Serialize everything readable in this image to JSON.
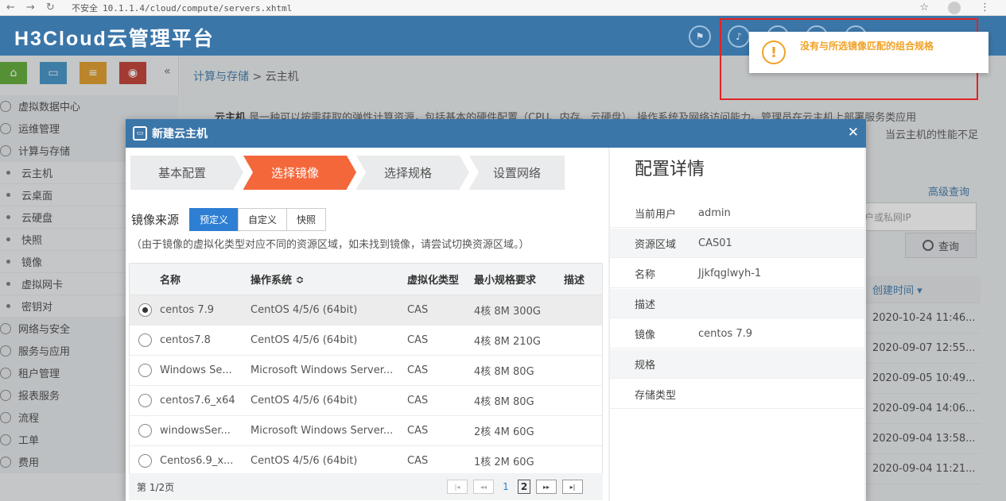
{
  "browser": {
    "security_label": "不安全",
    "url": "10.1.1.4/cloud/compute/servers.xhtml"
  },
  "header": {
    "brand": "H3Cloud云管理平台"
  },
  "sidebar": {
    "quick_colors": [
      "#5aaa2e",
      "#3b8fc6",
      "#e09a21",
      "#c0392b"
    ],
    "items": [
      {
        "label": "虚拟数据中心",
        "kind": "group"
      },
      {
        "label": "运维管理",
        "kind": "group"
      },
      {
        "label": "计算与存储",
        "kind": "group"
      },
      {
        "label": "云主机",
        "kind": "sub"
      },
      {
        "label": "云桌面",
        "kind": "sub"
      },
      {
        "label": "云硬盘",
        "kind": "sub"
      },
      {
        "label": "快照",
        "kind": "sub"
      },
      {
        "label": "镜像",
        "kind": "sub"
      },
      {
        "label": "虚拟网卡",
        "kind": "sub"
      },
      {
        "label": "密钥对",
        "kind": "sub"
      },
      {
        "label": "网络与安全",
        "kind": "group"
      },
      {
        "label": "服务与应用",
        "kind": "group"
      },
      {
        "label": "租户管理",
        "kind": "group"
      },
      {
        "label": "报表服务",
        "kind": "group"
      },
      {
        "label": "流程",
        "kind": "group"
      },
      {
        "label": "工单",
        "kind": "group"
      },
      {
        "label": "费用",
        "kind": "group"
      }
    ]
  },
  "main": {
    "breadcrumb_link": "计算与存储",
    "breadcrumb_sep": " > ",
    "breadcrumb_current": "云主机",
    "intro_bold": "云主机",
    "intro_line1": "是一种可以按需获取的弹性计算资源，包括基本的硬件配置（CPU、内存、云硬盘）、操作系统及网络访问能力。管理员在云主机上部署服务类应用",
    "intro_line2": "当云主机的性能不足时，",
    "advanced_search": "高级查询",
    "search_placeholder": "户或私网IP",
    "query_button": "查询",
    "created_header": "创建时间 ▾",
    "created_values": [
      "2020-10-24 11:46...",
      "2020-09-07 12:55...",
      "2020-09-05 10:49...",
      "2020-09-04 14:06...",
      "2020-09-04 13:58...",
      "2020-09-04 11:21..."
    ]
  },
  "dialog": {
    "title": "新建云主机",
    "steps": [
      "基本配置",
      "选择镜像",
      "选择规格",
      "设置网络"
    ],
    "active_step": 1,
    "source_label": "镜像来源",
    "source_tabs": [
      "预定义",
      "自定义",
      "快照"
    ],
    "hint": "（由于镜像的虚拟化类型对应不同的资源区域，如未找到镜像，请尝试切换资源区域。）",
    "table": {
      "headers": [
        "名称",
        "操作系统 ≎",
        "虚拟化类型",
        "最小规格要求",
        "描述"
      ],
      "rows": [
        {
          "name": "centos 7.9",
          "os": "CentOS 4/5/6 (64bit)",
          "virt": "CAS",
          "min": "4核 8M 300G",
          "desc": "",
          "selected": true
        },
        {
          "name": "centos7.8",
          "os": "CentOS 4/5/6 (64bit)",
          "virt": "CAS",
          "min": "4核 8M 210G",
          "desc": "",
          "selected": false
        },
        {
          "name": "Windows Se...",
          "os": "Microsoft Windows Server...",
          "virt": "CAS",
          "min": "4核 8M 80G",
          "desc": "",
          "selected": false
        },
        {
          "name": "centos7.6_x64",
          "os": "CentOS 4/5/6 (64bit)",
          "virt": "CAS",
          "min": "4核 8M 80G",
          "desc": "",
          "selected": false
        },
        {
          "name": "windowsSer...",
          "os": "Microsoft Windows Server...",
          "virt": "CAS",
          "min": "2核 4M 60G",
          "desc": "",
          "selected": false
        },
        {
          "name": "Centos6.9_x...",
          "os": "CentOS 4/5/6 (64bit)",
          "virt": "CAS",
          "min": "1核 2M 60G",
          "desc": "",
          "selected": false
        }
      ]
    },
    "pager": {
      "info": "第 1/2页",
      "pages": [
        "1",
        "2"
      ]
    },
    "details": {
      "title": "配置详情",
      "rows": [
        {
          "k": "当前用户",
          "v": "admin"
        },
        {
          "k": "资源区域",
          "v": "CAS01"
        },
        {
          "k": "名称",
          "v": "Jjkfqglwyh-1"
        },
        {
          "k": "描述",
          "v": ""
        },
        {
          "k": "镜像",
          "v": "centos 7.9"
        },
        {
          "k": "规格",
          "v": ""
        },
        {
          "k": "存储类型",
          "v": ""
        }
      ]
    }
  },
  "toast": {
    "message": "没有与所选镜像匹配的组合规格",
    "icon": "exclamation-icon"
  }
}
